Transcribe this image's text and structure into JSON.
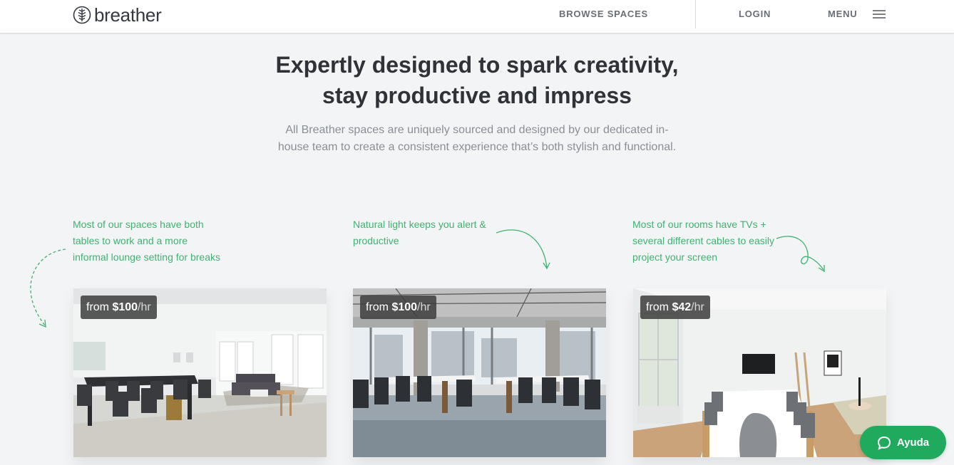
{
  "header": {
    "logo_text": "breather",
    "browse_label": "BROWSE SPACES",
    "login_label": "LOGIN",
    "menu_label": "MENU"
  },
  "hero": {
    "headline_line1": "Expertly designed to spark creativity,",
    "headline_line2": "stay productive and impress",
    "subtext_line1": "All Breather spaces are uniquely sourced and designed by our dedicated in-",
    "subtext_line2": "house team to create a consistent experience that’s both stylish and functional."
  },
  "features": [
    {
      "note_lines": [
        "Most of our spaces have both",
        "tables to work and a more",
        "informal lounge setting for breaks"
      ],
      "price_prefix": "from ",
      "price_amount": "$100",
      "price_unit": "/hr"
    },
    {
      "note_lines": [
        "Natural light keeps you alert &",
        "productive"
      ],
      "price_prefix": "from ",
      "price_amount": "$100",
      "price_unit": "/hr"
    },
    {
      "note_lines": [
        "Most of our rooms have TVs +",
        "several different cables to easily",
        "project your screen"
      ],
      "price_prefix": "from ",
      "price_amount": "$42",
      "price_unit": "/hr"
    }
  ],
  "help": {
    "label": "Ayuda"
  },
  "colors": {
    "accent_green": "#3fb26f",
    "help_green": "#1faa5e",
    "text_dark": "#2f3337",
    "nav_gray": "#6a6f76"
  },
  "icons": {
    "logo": "tree-leaf-icon",
    "menu": "hamburger-icon",
    "help": "chat-bubble-icon"
  }
}
